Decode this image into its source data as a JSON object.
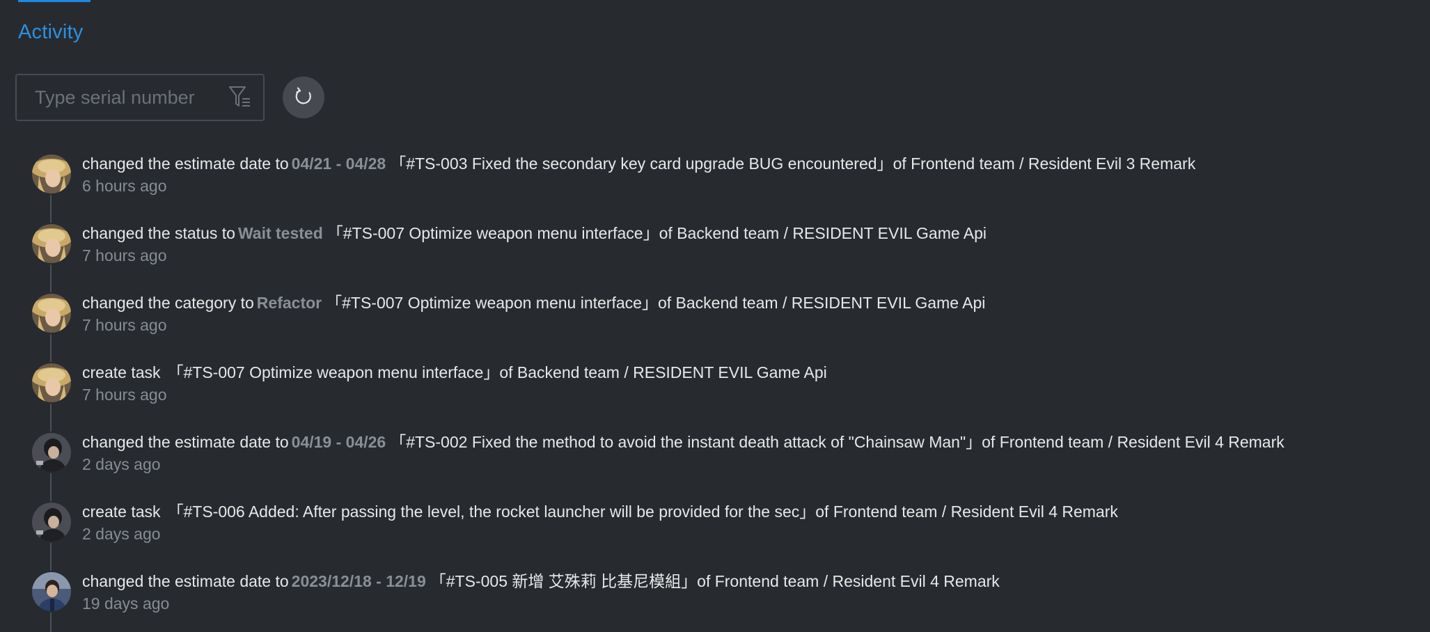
{
  "section": {
    "title": "Activity"
  },
  "search": {
    "placeholder": "Type serial number",
    "value": "",
    "filter_icon": "filter-icon",
    "refresh_icon": "refresh-icon"
  },
  "activities": [
    {
      "avatar": "avatar-blonde-hat",
      "action": "changed the estimate date to",
      "value": "04/21 - 04/28",
      "task": "「#TS-003 Fixed the secondary key card upgrade BUG encountered」",
      "team": "of Frontend team / Resident Evil 3 Remark",
      "time": "6 hours ago"
    },
    {
      "avatar": "avatar-blonde-hat",
      "action": "changed the status to",
      "value": "Wait tested",
      "task": "「#TS-007 Optimize weapon menu interface」",
      "team": "of Backend team / RESIDENT EVIL Game Api",
      "time": "7 hours ago"
    },
    {
      "avatar": "avatar-blonde-hat",
      "action": "changed the category to",
      "value": "Refactor",
      "task": "「#TS-007 Optimize weapon menu interface」",
      "team": "of Backend team / RESIDENT EVIL Game Api",
      "time": "7 hours ago"
    },
    {
      "avatar": "avatar-blonde-hat",
      "action": "create task",
      "value": "",
      "task": "「#TS-007 Optimize weapon menu interface」",
      "team": "of Backend team / RESIDENT EVIL Game Api",
      "time": "7 hours ago"
    },
    {
      "avatar": "avatar-dark-hair",
      "action": "changed the estimate date to",
      "value": "04/19 - 04/26",
      "task": "「#TS-002 Fixed the method to avoid the instant death attack of \"Chainsaw Man\"」",
      "team": "of Frontend team / Resident Evil 4 Remark",
      "time": "2 days ago"
    },
    {
      "avatar": "avatar-dark-hair",
      "action": "create task",
      "value": "",
      "task": "「#TS-006 Added: After passing the level, the rocket launcher will be provided for the sec」",
      "team": "of Frontend team / Resident Evil 4 Remark",
      "time": "2 days ago"
    },
    {
      "avatar": "avatar-blue-jacket",
      "action": "changed the estimate date to",
      "value": "2023/12/18 - 12/19",
      "task": "「#TS-005 新增 艾殊莉 比基尼模組」",
      "team": "of Frontend team / Resident Evil 4 Remark",
      "time": "19 days ago"
    }
  ],
  "colors": {
    "background": "#272b30",
    "accent": "#2e8fe0",
    "muted": "#878c93"
  }
}
